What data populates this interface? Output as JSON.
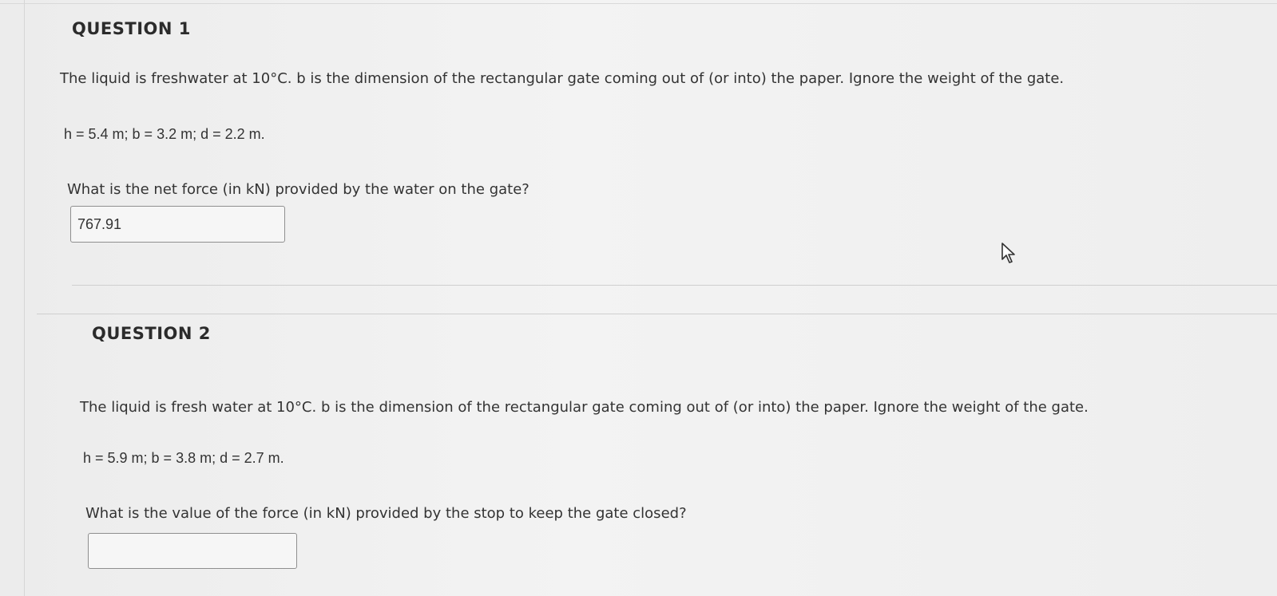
{
  "question1": {
    "title": "QUESTION 1",
    "description": "The liquid is freshwater at 10°C. b is the dimension of the rectangular gate coming out of (or into) the paper. Ignore the weight of the gate.",
    "given": "h = 5.4 m; b = 3.2 m; d = 2.2 m.",
    "prompt": "What is the net force (in kN) provided by the water on the gate?",
    "answer_value": "767.91"
  },
  "question2": {
    "title": "QUESTION 2",
    "description": "The liquid is fresh water at 10°C. b is the dimension of the rectangular gate coming out of (or into) the paper. Ignore the weight of the gate.",
    "given": "h = 5.9 m; b = 3.8 m; d = 2.7 m.",
    "prompt": "What is the value of the force (in kN) provided by the stop to keep the gate closed?",
    "answer_value": ""
  },
  "cursor_icon": "arrow-pointer-icon"
}
